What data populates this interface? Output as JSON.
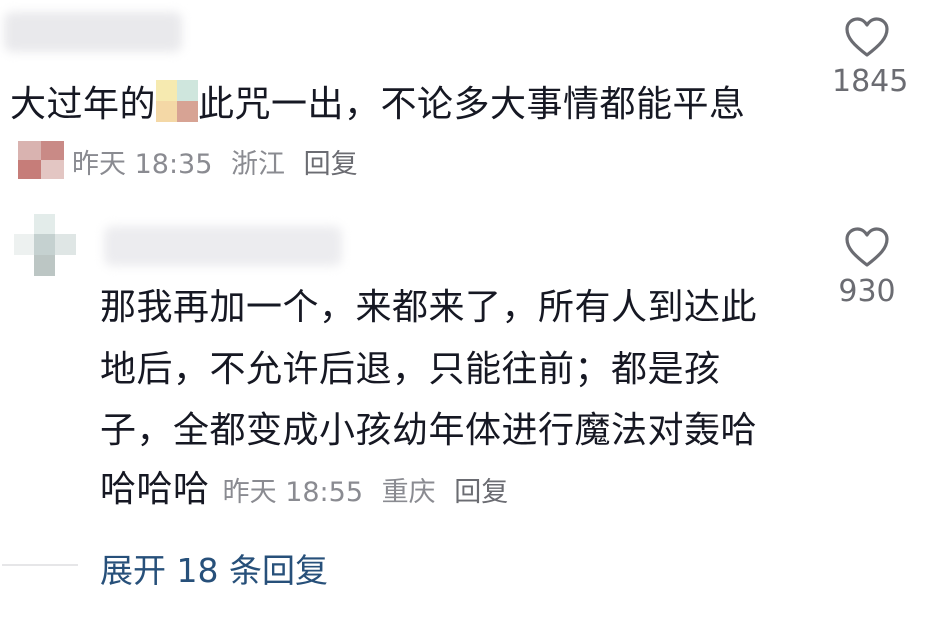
{
  "comment": {
    "text_line1": "大过年的",
    "text_line1_after": "此咒一出，不论多大事情都能平息",
    "time": "昨天 18:35",
    "location": "浙江",
    "reply_label": "回复",
    "like_count": "1845",
    "like_icon": "heart-outline-icon"
  },
  "reply": {
    "lines": [
      "那我再加一个，来都来了，所有人到达此",
      "地后，不允许后退，只能往前；都是孩",
      "子，全都变成小孩幼年体进行魔法对轰哈"
    ],
    "last_line_text": "哈哈哈",
    "time": "昨天 18:55",
    "location": "重庆",
    "reply_label": "回复",
    "like_count": "930",
    "like_icon": "heart-outline-icon"
  },
  "expand_label": "展开 18 条回复",
  "colors": {
    "text": "#161823",
    "meta": "#8a8b91",
    "link": "#27507a"
  }
}
